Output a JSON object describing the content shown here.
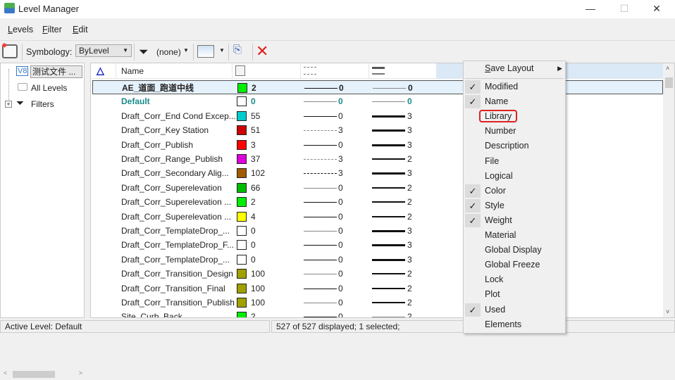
{
  "window": {
    "title": "Level Manager",
    "minimize": "—",
    "maximize": "☐",
    "close": "✕"
  },
  "menubar": [
    {
      "pre": "",
      "u": "L",
      "post": "evels"
    },
    {
      "pre": "",
      "u": "F",
      "post": "ilter"
    },
    {
      "pre": "",
      "u": "E",
      "post": "dit"
    }
  ],
  "toolbar": {
    "symbology_label": "Symbology:",
    "symbology_value": "ByLevel",
    "filter_value": "(none)"
  },
  "tree": {
    "file": "测试文件 ...",
    "file_badge": "V8",
    "all_levels": "All Levels",
    "filters": "Filters"
  },
  "grid": {
    "columns": {
      "name": "Name"
    },
    "rows": [
      {
        "name": "AE_道面_跑道中线",
        "color": "#00ee00",
        "color_num": "2",
        "style": "0",
        "style_type": "solid",
        "weight": "0",
        "weight_w": 1,
        "bold": true,
        "selected": true
      },
      {
        "name": "Default",
        "color": "#ffffff",
        "color_num": "0",
        "style": "0",
        "style_type": "solid-gray",
        "weight": "0",
        "weight_w": 1,
        "active": true
      },
      {
        "name": "Draft_Corr_End Cond Excep...",
        "color": "#00cccc",
        "color_num": "55",
        "style": "0",
        "style_type": "solid",
        "weight": "3",
        "weight_w": 3
      },
      {
        "name": "Draft_Corr_Key Station",
        "color": "#cc0000",
        "color_num": "51",
        "style": "3",
        "style_type": "dash-gray",
        "weight": "3",
        "weight_w": 3
      },
      {
        "name": "Draft_Corr_Publish",
        "color": "#ff0000",
        "color_num": "3",
        "style": "0",
        "style_type": "solid",
        "weight": "3",
        "weight_w": 3
      },
      {
        "name": "Draft_Corr_Range_Publish",
        "color": "#dd00dd",
        "color_num": "37",
        "style": "3",
        "style_type": "dash-gray",
        "weight": "2",
        "weight_w": 2.5
      },
      {
        "name": "Draft_Corr_Secondary Alig...",
        "color": "#a05a00",
        "color_num": "102",
        "style": "3",
        "style_type": "dash",
        "weight": "3",
        "weight_w": 3
      },
      {
        "name": "Draft_Corr_Superelevation",
        "color": "#00bb00",
        "color_num": "66",
        "style": "0",
        "style_type": "solid-gray",
        "weight": "2",
        "weight_w": 2.5
      },
      {
        "name": "Draft_Corr_Superelevation ...",
        "color": "#00ee00",
        "color_num": "2",
        "style": "0",
        "style_type": "solid",
        "weight": "2",
        "weight_w": 2.5
      },
      {
        "name": "Draft_Corr_Superelevation ...",
        "color": "#ffff00",
        "color_num": "4",
        "style": "0",
        "style_type": "solid",
        "weight": "2",
        "weight_w": 2.5
      },
      {
        "name": "Draft_Corr_TemplateDrop_...",
        "color": "#ffffff",
        "color_num": "0",
        "style": "0",
        "style_type": "solid-gray",
        "weight": "3",
        "weight_w": 3
      },
      {
        "name": "Draft_Corr_TemplateDrop_F...",
        "color": "#ffffff",
        "color_num": "0",
        "style": "0",
        "style_type": "solid",
        "weight": "3",
        "weight_w": 3
      },
      {
        "name": "Draft_Corr_TemplateDrop_...",
        "color": "#ffffff",
        "color_num": "0",
        "style": "0",
        "style_type": "solid",
        "weight": "3",
        "weight_w": 3
      },
      {
        "name": "Draft_Corr_Transition_Design",
        "color": "#a0a000",
        "color_num": "100",
        "style": "0",
        "style_type": "solid-gray",
        "weight": "2",
        "weight_w": 2.5
      },
      {
        "name": "Draft_Corr_Transition_Final",
        "color": "#a0a000",
        "color_num": "100",
        "style": "0",
        "style_type": "solid",
        "weight": "2",
        "weight_w": 2.5
      },
      {
        "name": "Draft_Corr_Transition_Publish",
        "color": "#a0a000",
        "color_num": "100",
        "style": "0",
        "style_type": "solid-gray",
        "weight": "2",
        "weight_w": 2.5
      },
      {
        "name": "Site_Curb_Back",
        "color": "#00ee00",
        "color_num": "2",
        "style": "0",
        "style_type": "solid",
        "weight": "2",
        "weight_w": 1
      }
    ]
  },
  "status": {
    "active_level": "Active Level: Default",
    "count": "527 of 527 displayed; 1 selected;"
  },
  "context_menu": {
    "save_layout": {
      "u": "S",
      "rest": "ave Layout"
    },
    "items": [
      {
        "label": "Modified",
        "checked": true
      },
      {
        "label": "Name",
        "checked": true
      },
      {
        "label": "Library",
        "checked": false,
        "highlight": true
      },
      {
        "label": "Number",
        "checked": false
      },
      {
        "label": "Description",
        "checked": false
      },
      {
        "label": "File",
        "checked": false
      },
      {
        "label": "Logical",
        "checked": false
      },
      {
        "label": "Color",
        "checked": true
      },
      {
        "label": "Style",
        "checked": true
      },
      {
        "label": "Weight",
        "checked": true
      },
      {
        "label": "Material",
        "checked": false
      },
      {
        "label": "Global Display",
        "checked": false
      },
      {
        "label": "Global Freeze",
        "checked": false
      },
      {
        "label": "Lock",
        "checked": false
      },
      {
        "label": "Plot",
        "checked": false
      },
      {
        "label": "Used",
        "checked": true
      },
      {
        "label": "Elements",
        "checked": false
      }
    ]
  }
}
